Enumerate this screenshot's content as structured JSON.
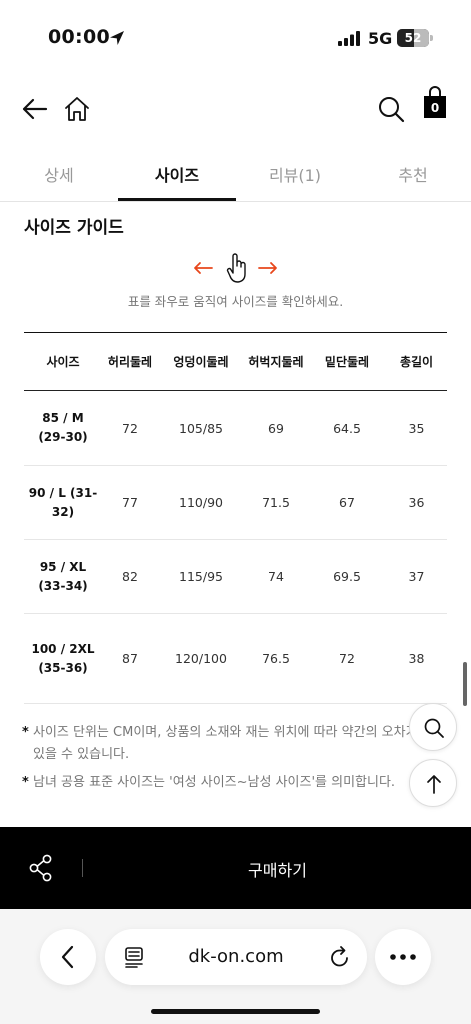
{
  "status_bar": {
    "time": "00:00",
    "network": "5G",
    "battery": "52",
    "battery_level": 0.52
  },
  "tabs": [
    {
      "label": "상세"
    },
    {
      "label": "사이즈"
    },
    {
      "label": "리뷰(1)"
    },
    {
      "label": "추천"
    }
  ],
  "cart": {
    "count": "0"
  },
  "size_guide": {
    "title": "사이즈 가이드",
    "hint": "표를 좌우로 움직여 사이즈를 확인하세요.",
    "columns": [
      "사이즈",
      "허리둘레",
      "엉덩이둘레",
      "허벅지둘레",
      "밑단둘레",
      "총길이"
    ],
    "rows": [
      [
        "85 / M (29-30)",
        "72",
        "105/85",
        "69",
        "64.5",
        "35"
      ],
      [
        "90 / L (31-32)",
        "77",
        "110/90",
        "71.5",
        "67",
        "36"
      ],
      [
        "95 / XL (33-34)",
        "82",
        "115/95",
        "74",
        "69.5",
        "37"
      ],
      [
        "100 / 2XL (35-36)",
        "87",
        "120/100",
        "76.5",
        "72",
        "38"
      ]
    ]
  },
  "notes": [
    {
      "star": "*",
      "text": "사이즈 단위는 CM이며, 상품의 소재와 재는 위치에 따라 약간의 오차가 있을 수 있습니다."
    },
    {
      "star": "*",
      "text": "남녀 공용 표준 사이즈는 '여성 사이즈~남성 사이즈'를 의미합니다."
    }
  ],
  "purchase": {
    "label": "구매하기"
  },
  "browser": {
    "url": "dk-on.com"
  },
  "colors": {
    "accent_arrow": "#e8471c",
    "bar": "#000000"
  },
  "icons": {
    "back": "arrow-left-icon",
    "home": "home-icon",
    "search": "search-icon",
    "bag": "shopping-bag-icon",
    "share": "share-icon",
    "scroll_top": "arrow-up-icon",
    "hand": "hand-pointer-icon"
  }
}
